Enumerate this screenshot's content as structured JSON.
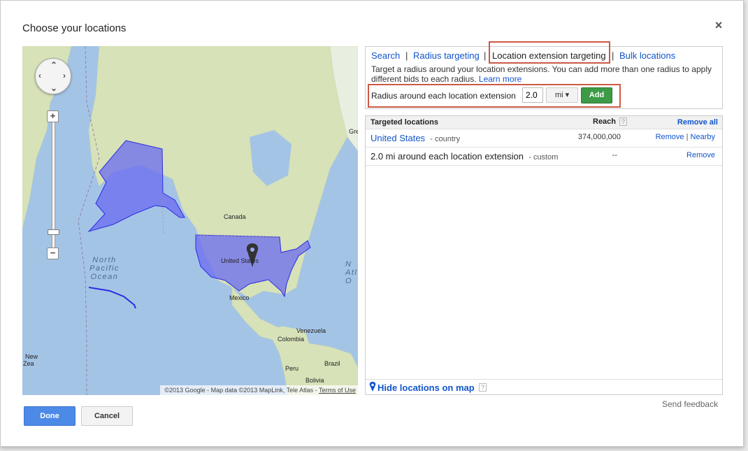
{
  "dialog": {
    "title": "Choose your locations",
    "close_glyph": "×"
  },
  "map": {
    "labels": {
      "canada": "Canada",
      "united_states": "United States",
      "mexico": "Mexico",
      "venezuela": "Venezuela",
      "colombia": "Colombia",
      "peru": "Peru",
      "brazil": "Brazil",
      "bolivia": "Bolivia",
      "new": "New",
      "zealand": "Zea",
      "gre": "Gre"
    },
    "north_pacific_ocean": [
      "North",
      "Pacific",
      "Ocean"
    ],
    "north_atlantic_fragment": [
      "N",
      "Atl",
      "O"
    ],
    "copyright": "©2013 Google - Map data ©2013 MapLink, Tele Atlas - ",
    "terms_of_use": "Terms of Use",
    "zoom_in": "+",
    "zoom_out": "−",
    "colors": {
      "ocean": "#a4c4e6",
      "land": "#d7e2b8",
      "selected_fill": "#6b6bf0",
      "selected_stroke": "#2c2ce0"
    },
    "icons": {
      "pan": "pan-control-icon",
      "marker": "location-pin-icon"
    }
  },
  "tabs": {
    "search": "Search",
    "radius": "Radius targeting",
    "location_extension": "Location extension targeting",
    "bulk": "Bulk locations",
    "separator": "|"
  },
  "location_extension": {
    "description": "Target a radius around your location extensions. You can add more than one radius to apply different bids to each radius.",
    "learn_more": "Learn more",
    "radius_label": "Radius around each location extension",
    "radius_value": "2.0",
    "unit": "mi",
    "add_label": "Add"
  },
  "targeted": {
    "header_locations": "Targeted locations",
    "header_reach": "Reach",
    "help": "?",
    "remove_all": "Remove all",
    "rows": [
      {
        "name": "United States",
        "kind": "- country",
        "reach": "374,000,000",
        "remove": "Remove",
        "nearby": "Nearby"
      },
      {
        "name": "2.0 mi around each location extension",
        "kind": "- custom",
        "reach": "--",
        "remove": "Remove"
      }
    ],
    "hide_on_map": "Hide locations on map"
  },
  "footer": {
    "send_feedback": "Send feedback",
    "done": "Done",
    "cancel": "Cancel"
  },
  "colors": {
    "link": "#1155cc",
    "highlight_box": "#cc5a45",
    "add_button": "#3d9a46",
    "done_button": "#4d8ae8"
  }
}
